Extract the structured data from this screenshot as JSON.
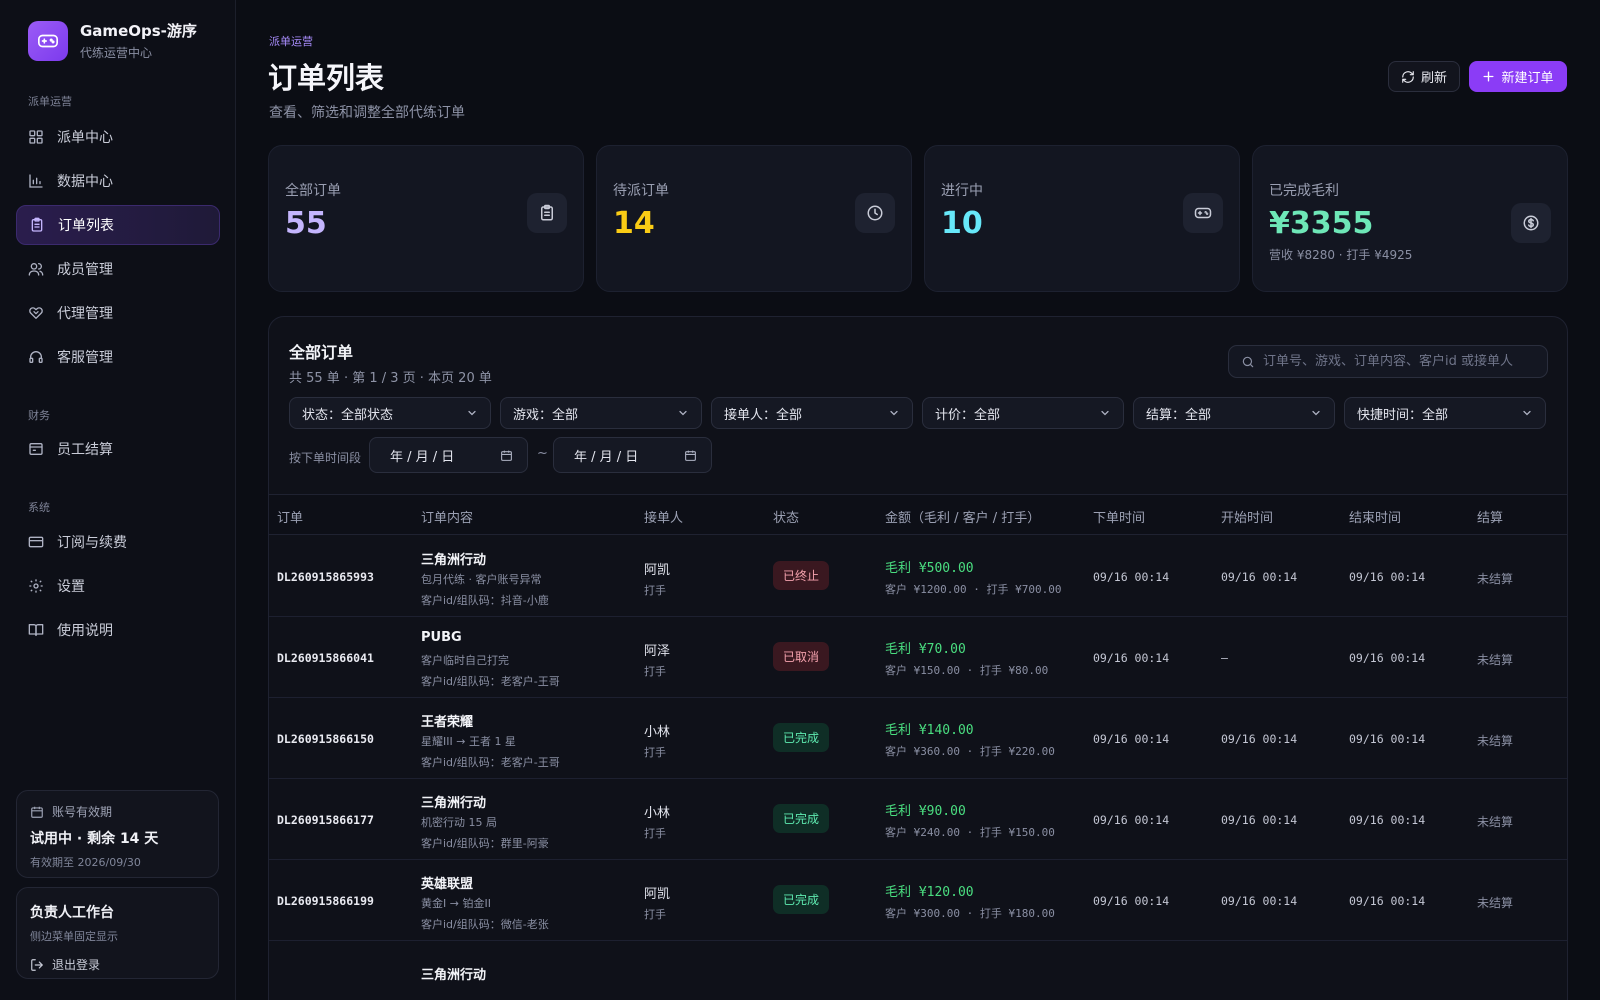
{
  "brand": {
    "name": "GameOps-游序",
    "subtitle": "代练运营中心"
  },
  "sidebar": {
    "sections": [
      "派单运营",
      "财务",
      "系统"
    ],
    "items": [
      {
        "label": "派单中心",
        "icon": "grid-icon"
      },
      {
        "label": "数据中心",
        "icon": "bar-chart-icon"
      },
      {
        "label": "订单列表",
        "icon": "clipboard-icon",
        "active": true
      },
      {
        "label": "成员管理",
        "icon": "users-icon"
      },
      {
        "label": "代理管理",
        "icon": "handshake-icon"
      },
      {
        "label": "客服管理",
        "icon": "headset-icon"
      },
      {
        "label": "员工结算",
        "icon": "wallet-icon"
      },
      {
        "label": "订阅与续费",
        "icon": "credit-card-icon"
      },
      {
        "label": "设置",
        "icon": "gear-icon"
      },
      {
        "label": "使用说明",
        "icon": "book-icon"
      }
    ],
    "account": {
      "label": "账号有效期",
      "status": "试用中 · 剩余 14 天",
      "expiry": "有效期至 2026/09/30"
    },
    "workspace": {
      "title": "负责人工作台",
      "note": "侧边菜单固定显示",
      "logout": "退出登录"
    }
  },
  "header": {
    "breadcrumb": "派单运营",
    "title": "订单列表",
    "description": "查看、筛选和调整全部代练订单",
    "refresh_label": "刷新",
    "new_label": "新建订单"
  },
  "stats": [
    {
      "label": "全部订单",
      "value": "55",
      "color": "#c4b5fd",
      "icon": "clipboard-icon"
    },
    {
      "label": "待派订单",
      "value": "14",
      "color": "#facc15",
      "icon": "clock-icon"
    },
    {
      "label": "进行中",
      "value": "10",
      "color": "#67e8f9",
      "icon": "gamepad-icon"
    },
    {
      "label": "已完成毛利",
      "value": "¥3355",
      "sub": "营收 ¥8280 · 打手 ¥4925",
      "color": "#6ee7b7",
      "icon": "dollar-icon"
    }
  ],
  "orders_panel": {
    "title": "全部订单",
    "summary": "共 55 单 · 第 1 / 3 页 · 本页 20 单",
    "search_placeholder": "订单号、游戏、订单内容、客户id 或接单人",
    "filters": [
      "状态：全部状态",
      "游戏：全部",
      "接单人：全部",
      "计价：全部",
      "结算：全部",
      "快捷时间：全部"
    ],
    "date_range_label": "按下单时间段",
    "date_placeholder": "年 / 月 / 日",
    "date_separator": "~",
    "columns": [
      "订单",
      "订单内容",
      "接单人",
      "状态",
      "金额（毛利 / 客户 / 打手）",
      "下单时间",
      "开始时间",
      "结束时间",
      "结算"
    ],
    "rows": [
      {
        "id": "DL260915865993",
        "game": "三角洲行动",
        "detail": "包月代练 · 客户账号异常",
        "customer": "客户id/组队码：抖音-小鹿",
        "worker": "阿凯",
        "role": "打手",
        "status": "已终止",
        "status_color": "red",
        "profit": "毛利 ¥500.00",
        "split": "客户 ¥1200.00 · 打手 ¥700.00",
        "order_time": "09/16 00:14",
        "start_time": "09/16 00:14",
        "end_time": "09/16 00:14",
        "settle": "未结算"
      },
      {
        "id": "DL260915866041",
        "game": "PUBG",
        "detail": "客户临时自己打完",
        "customer": "客户id/组队码：老客户-王哥",
        "worker": "阿泽",
        "role": "打手",
        "status": "已取消",
        "status_color": "red",
        "profit": "毛利 ¥70.00",
        "split": "客户 ¥150.00 · 打手 ¥80.00",
        "order_time": "09/16 00:14",
        "start_time": "—",
        "end_time": "09/16 00:14",
        "settle": "未结算"
      },
      {
        "id": "DL260915866150",
        "game": "王者荣耀",
        "detail": "星耀III → 王者 1 星",
        "customer": "客户id/组队码：老客户-王哥",
        "worker": "小林",
        "role": "打手",
        "status": "已完成",
        "status_color": "green",
        "profit": "毛利 ¥140.00",
        "split": "客户 ¥360.00 · 打手 ¥220.00",
        "order_time": "09/16 00:14",
        "start_time": "09/16 00:14",
        "end_time": "09/16 00:14",
        "settle": "未结算"
      },
      {
        "id": "DL260915866177",
        "game": "三角洲行动",
        "detail": "机密行动 15 局",
        "customer": "客户id/组队码：群里-阿豪",
        "worker": "小林",
        "role": "打手",
        "status": "已完成",
        "status_color": "green",
        "profit": "毛利 ¥90.00",
        "split": "客户 ¥240.00 · 打手 ¥150.00",
        "order_time": "09/16 00:14",
        "start_time": "09/16 00:14",
        "end_time": "09/16 00:14",
        "settle": "未结算"
      },
      {
        "id": "DL260915866199",
        "game": "英雄联盟",
        "detail": "黄金I → 铂金II",
        "customer": "客户id/组队码：微信-老张",
        "worker": "阿凯",
        "role": "打手",
        "status": "已完成",
        "status_color": "green",
        "profit": "毛利 ¥120.00",
        "split": "客户 ¥300.00 · 打手 ¥180.00",
        "order_time": "09/16 00:14",
        "start_time": "09/16 00:14",
        "end_time": "09/16 00:14",
        "settle": "未结算"
      }
    ],
    "partial_row_game": "三角洲行动"
  }
}
